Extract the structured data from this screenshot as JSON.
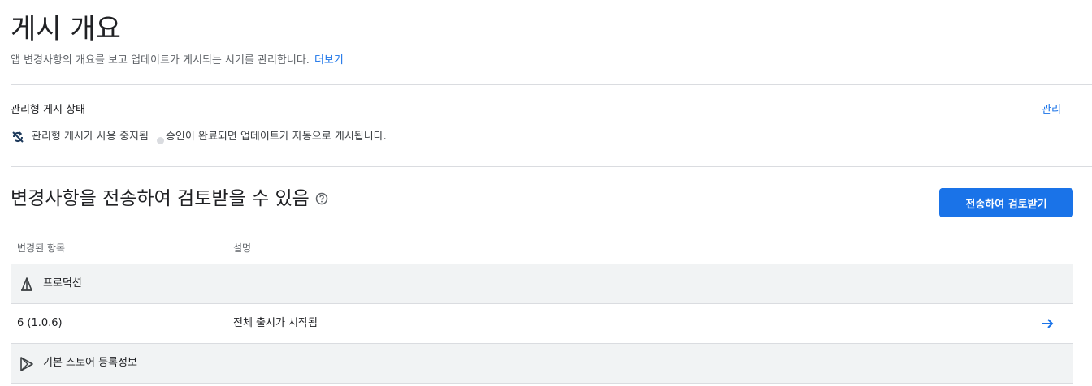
{
  "header": {
    "title": "게시 개요",
    "subtitle": "앱 변경사항의 개요를 보고 업데이트가 게시되는 시기를 관리합니다.",
    "learn_more": "더보기"
  },
  "managed_publishing": {
    "label": "관리형 게시 상태",
    "manage_link": "관리",
    "status_text": "관리형 게시가 사용 중지됨",
    "status_detail": "승인이 완료되면 업데이트가 자동으로 게시됩니다.",
    "status_icon": "sync-disabled-icon"
  },
  "review_section": {
    "title": "변경사항을 전송하여 검토받을 수 있음",
    "send_button": "전송하여 검토받기",
    "help_icon": "help-icon"
  },
  "table": {
    "columns": [
      "변경된 항목",
      "설명"
    ],
    "groups": [
      {
        "label": "프로덕션",
        "icon": "production-icon",
        "rows": [
          {
            "item": "6 (1.0.6)",
            "description": "전체 출시가 시작됨"
          }
        ]
      },
      {
        "label": "기본 스토어 등록정보",
        "icon": "store-play-icon",
        "rows": []
      }
    ]
  },
  "colors": {
    "accent": "#1a73e8",
    "divider": "#dadce0",
    "group_bg": "#f1f3f4"
  }
}
